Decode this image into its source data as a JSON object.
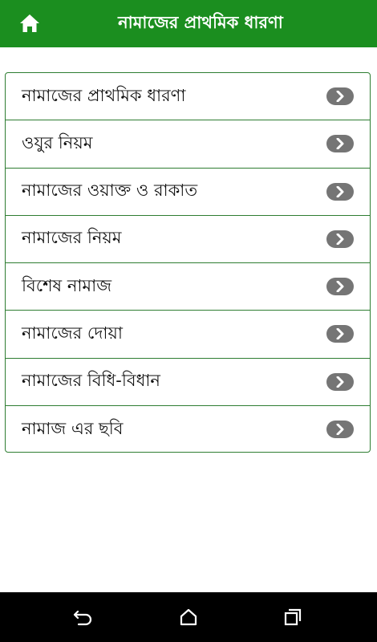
{
  "appbar": {
    "title": "নামাজের প্রাথমিক ধারণা",
    "color": "#1b8e1f",
    "home_icon": "home-icon"
  },
  "menu": {
    "items": [
      {
        "label": "নামাজের প্রাথমিক ধারণা"
      },
      {
        "label": "ওযুর নিয়ম"
      },
      {
        "label": "নামাজের ওয়াক্ত ও রাকাত"
      },
      {
        "label": "নামাজের নিয়ম"
      },
      {
        "label": "বিশেষ নামাজ"
      },
      {
        "label": "নামাজের দোয়া"
      },
      {
        "label": "নামাজের বিধি-বিধান"
      },
      {
        "label": "নামাজ এর ছবি"
      }
    ],
    "item_icon": "chevron-right-icon",
    "border_color": "#2e7d32"
  },
  "navbar": {
    "icons": [
      "back-icon",
      "home-icon",
      "recents-icon"
    ]
  }
}
